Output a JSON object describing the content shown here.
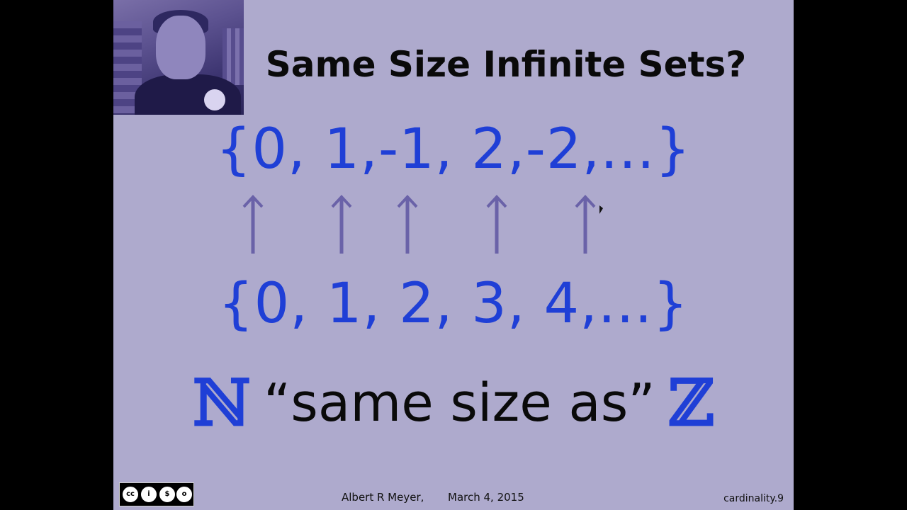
{
  "slide": {
    "title": "Same Size Infinite Sets?",
    "integers_set": "{0, 1,-1, 2,-2,...}",
    "naturals_set": "{0, 1, 2, 3, 4,...}",
    "symbol_n": "ℕ",
    "symbol_z": "ℤ",
    "phrase": "“same size as”"
  },
  "footer": {
    "author": "Albert R Meyer,",
    "date": "March 4, 2015",
    "slide_ref": "cardinality.9",
    "license_icons": [
      "cc-icon",
      "by-icon",
      "nc-icon",
      "sa-icon"
    ]
  },
  "colors": {
    "background": "#aeaacd",
    "accent_blue": "#1f3fd6",
    "arrow": "#6a62a8",
    "title": "#0a0a0a"
  }
}
